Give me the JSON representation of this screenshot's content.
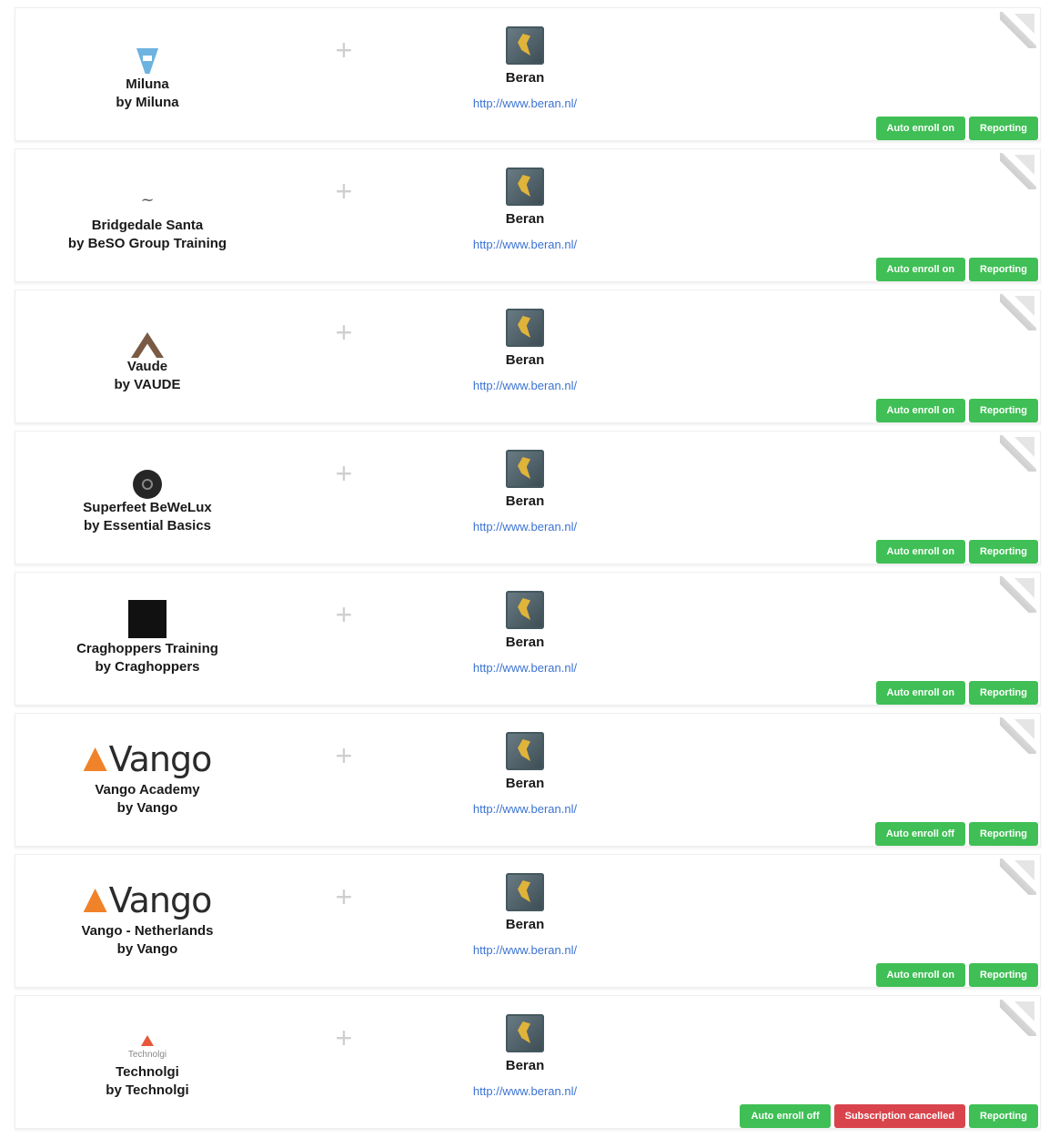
{
  "cards": [
    {
      "logo": "funnel-logo",
      "name": "Miluna",
      "by": "by Miluna",
      "partner": {
        "name": "Beran",
        "link": "http://www.beran.nl/"
      },
      "badges": [
        {
          "label": "Auto enroll on",
          "color": "#3fbf55"
        },
        {
          "label": "Reporting",
          "color": "#3fbf55"
        }
      ]
    },
    {
      "logo": "script-logo",
      "name": "Bridgedale Santa",
      "by": "by BeSO Group Training",
      "partner": {
        "name": "Beran",
        "link": "http://www.beran.nl/"
      },
      "badges": [
        {
          "label": "Auto enroll on",
          "color": "#3fbf55"
        },
        {
          "label": "Reporting",
          "color": "#3fbf55"
        }
      ]
    },
    {
      "logo": "triangle-logo",
      "name": "Vaude",
      "by": "by VAUDE",
      "partner": {
        "name": "Beran",
        "link": "http://www.beran.nl/"
      },
      "badges": [
        {
          "label": "Auto enroll on",
          "color": "#3fbf55"
        },
        {
          "label": "Reporting",
          "color": "#3fbf55"
        }
      ]
    },
    {
      "logo": "circle-logo",
      "name": "Superfeet BeWeLux",
      "by": "by Essential Basics",
      "partner": {
        "name": "Beran",
        "link": "http://www.beran.nl/"
      },
      "badges": [
        {
          "label": "Auto enroll on",
          "color": "#3fbf55"
        },
        {
          "label": "Reporting",
          "color": "#3fbf55"
        }
      ]
    },
    {
      "logo": "square-logo",
      "name": "Craghoppers Training",
      "by": "by Craghoppers",
      "partner": {
        "name": "Beran",
        "link": "http://www.beran.nl/"
      },
      "badges": [
        {
          "label": "Auto enroll on",
          "color": "#3fbf55"
        },
        {
          "label": "Reporting",
          "color": "#3fbf55"
        }
      ]
    },
    {
      "logo": "vango-logo",
      "logo_text": "Vango",
      "name": "Vango Academy",
      "by": "by Vango",
      "partner": {
        "name": "Beran",
        "link": "http://www.beran.nl/"
      },
      "badges": [
        {
          "label": "Auto enroll off",
          "color": "#3fbf55"
        },
        {
          "label": "Reporting",
          "color": "#3fbf55"
        }
      ]
    },
    {
      "logo": "vango-logo",
      "logo_text": "Vango",
      "name": "Vango - Netherlands",
      "by": "by Vango",
      "partner": {
        "name": "Beran",
        "link": "http://www.beran.nl/"
      },
      "badges": [
        {
          "label": "Auto enroll on",
          "color": "#3fbf55"
        },
        {
          "label": "Reporting",
          "color": "#3fbf55"
        }
      ]
    },
    {
      "logo": "technolgi-logo",
      "logo_text": "Technolgi",
      "name": "Technolgi",
      "by": "by Technolgi",
      "partner": {
        "name": "Beran",
        "link": "http://www.beran.nl/"
      },
      "badges": [
        {
          "label": "Auto enroll off",
          "color": "#3fbf55"
        },
        {
          "label": "Subscription cancelled",
          "color": "#d9434b"
        },
        {
          "label": "Reporting",
          "color": "#3fbf55"
        }
      ]
    }
  ]
}
